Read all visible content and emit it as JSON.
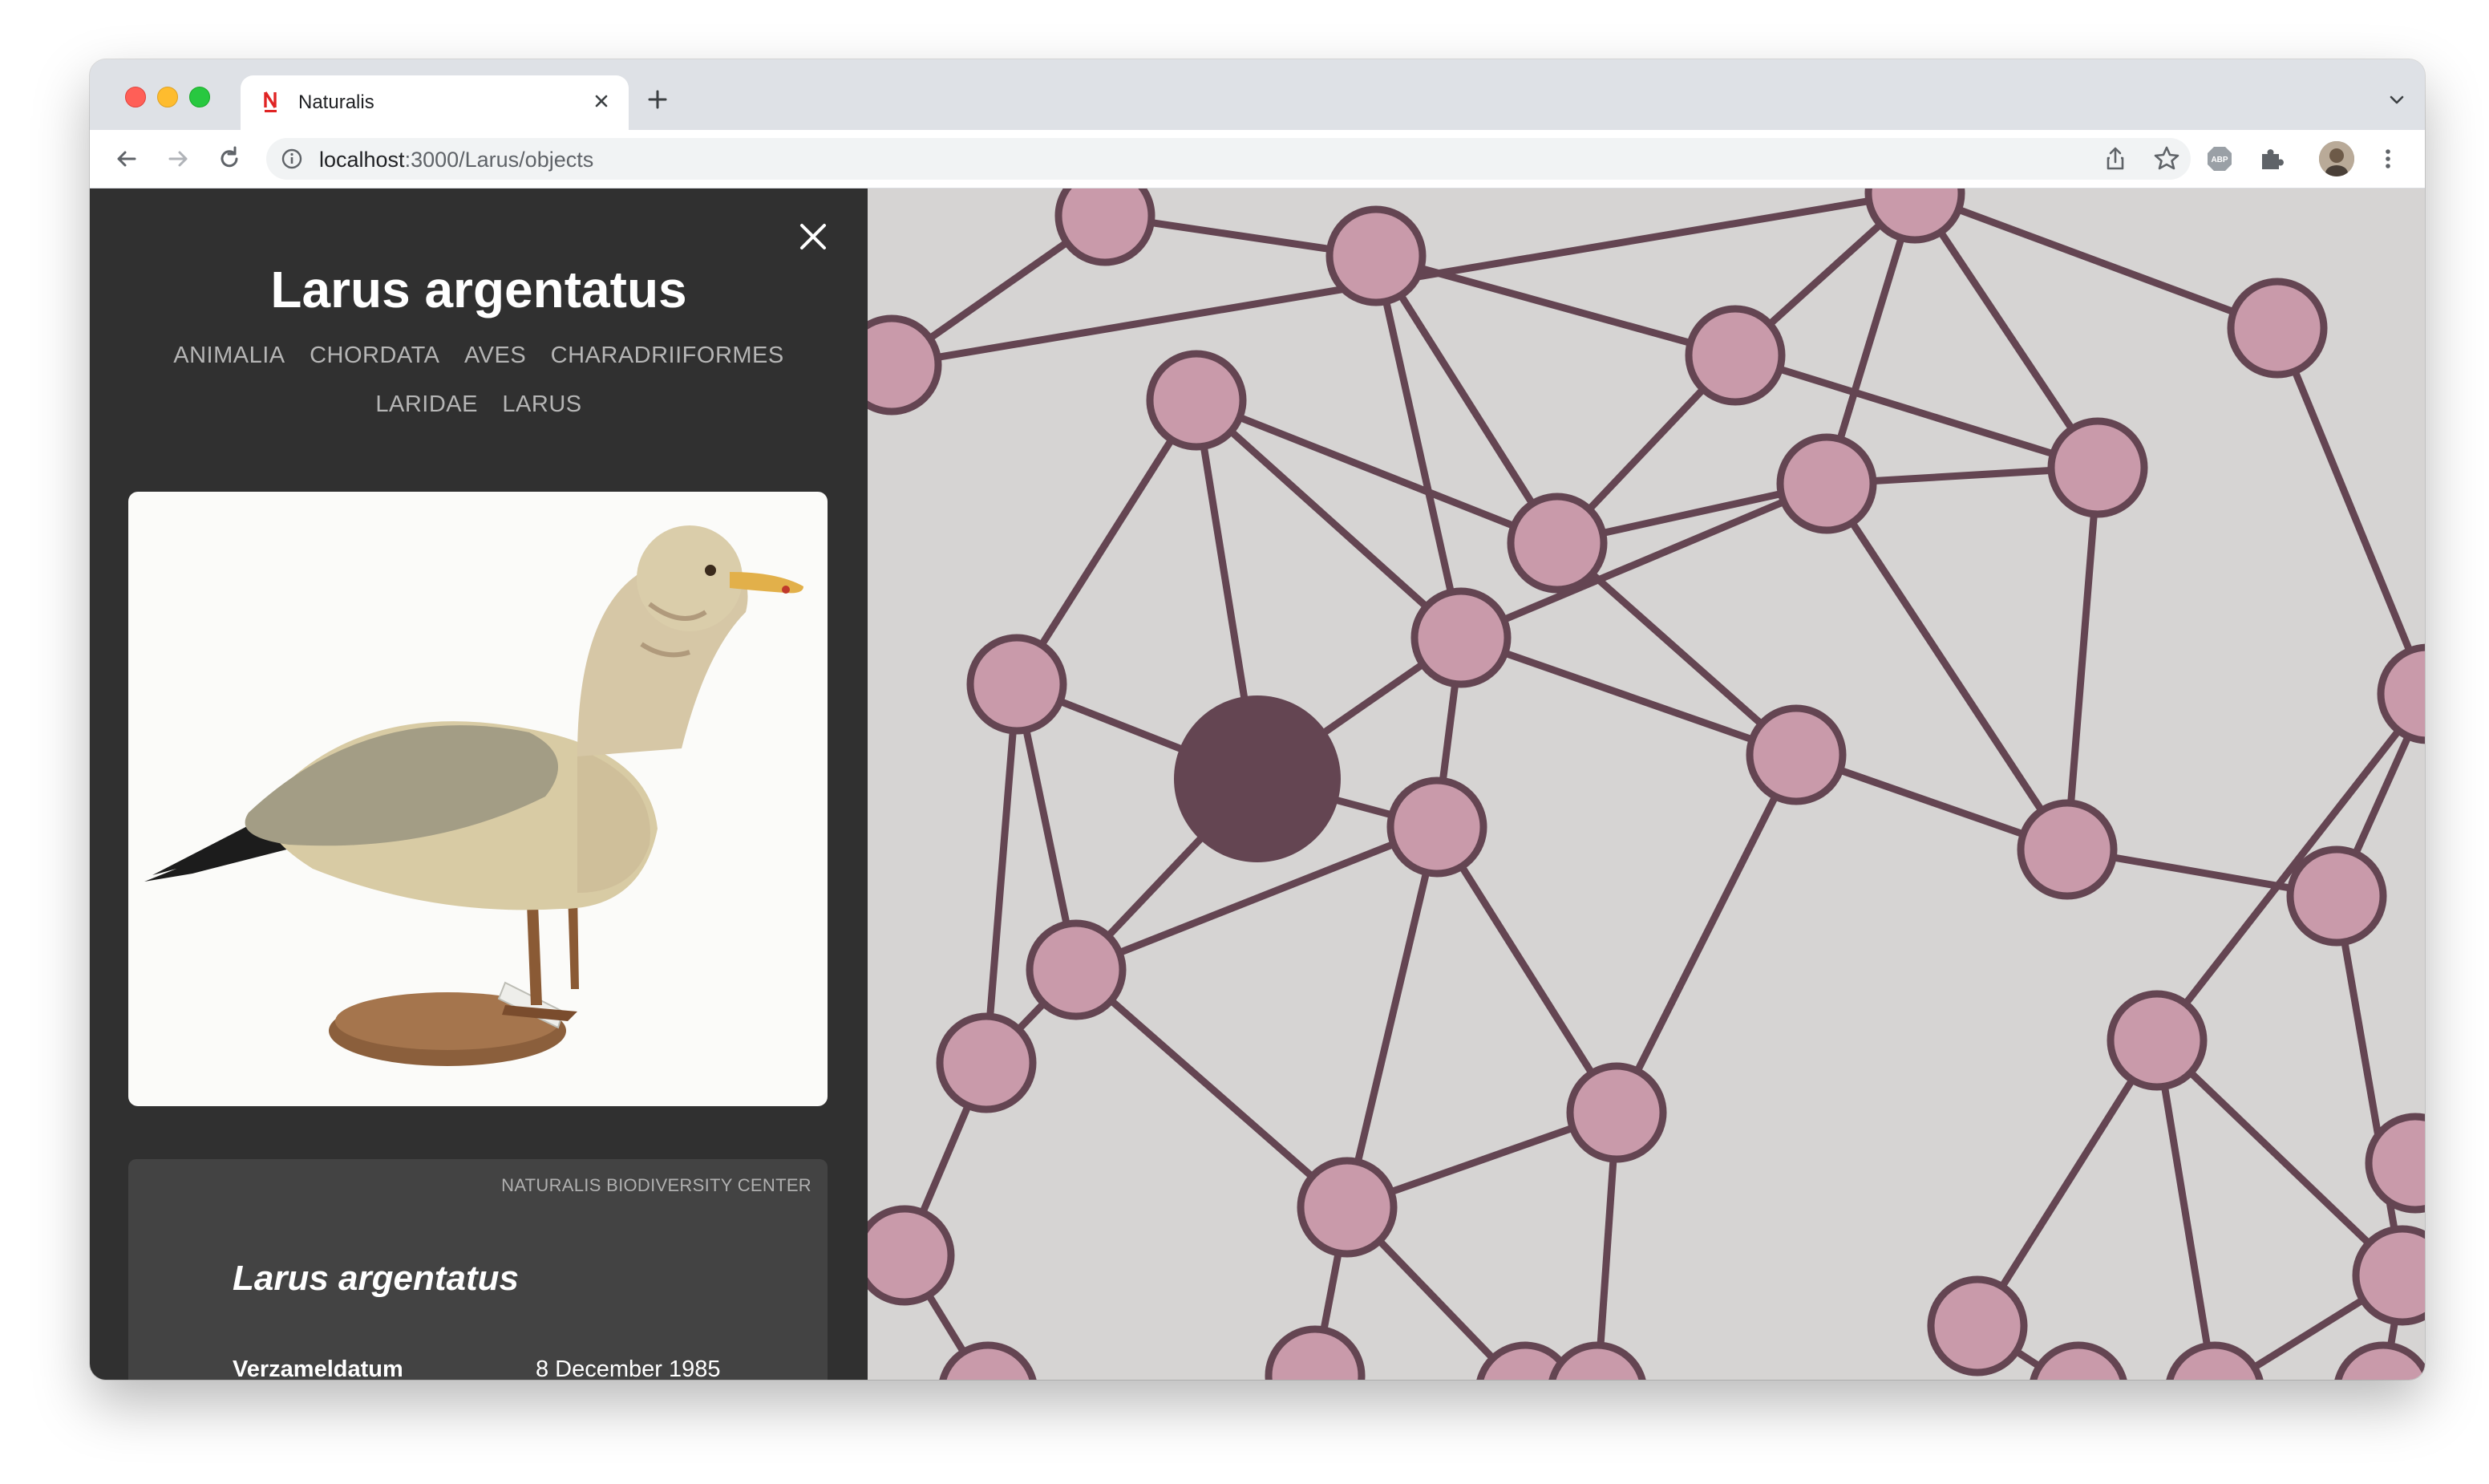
{
  "browser": {
    "tab_title": "Naturalis",
    "url_host": "localhost",
    "url_rest": ":3000/Larus/objects"
  },
  "panel": {
    "title": "Larus argentatus",
    "taxonomy": [
      "ANIMALIA",
      "CHORDATA",
      "AVES",
      "CHARADRIIFORMES",
      "LARIDAE",
      "LARUS"
    ],
    "card": {
      "source": "NATURALIS BIODIVERSITY CENTER",
      "title": "Larus argentatus",
      "fields": [
        {
          "label": "Verzameldatum",
          "value": "8 December 1985"
        }
      ]
    }
  },
  "colors": {
    "node_fill": "#c99aaa",
    "node_stroke": "#644552",
    "selected_node": "#644552",
    "graph_bg": "#d6d4d3",
    "panel_bg": "#303030"
  },
  "icons": [
    "close-icon",
    "back-icon",
    "forward-icon",
    "reload-icon",
    "info-icon",
    "share-icon",
    "star-icon",
    "adblock-icon",
    "extensions-icon",
    "menu-icon",
    "chevron-down-icon",
    "plus-icon"
  ]
}
